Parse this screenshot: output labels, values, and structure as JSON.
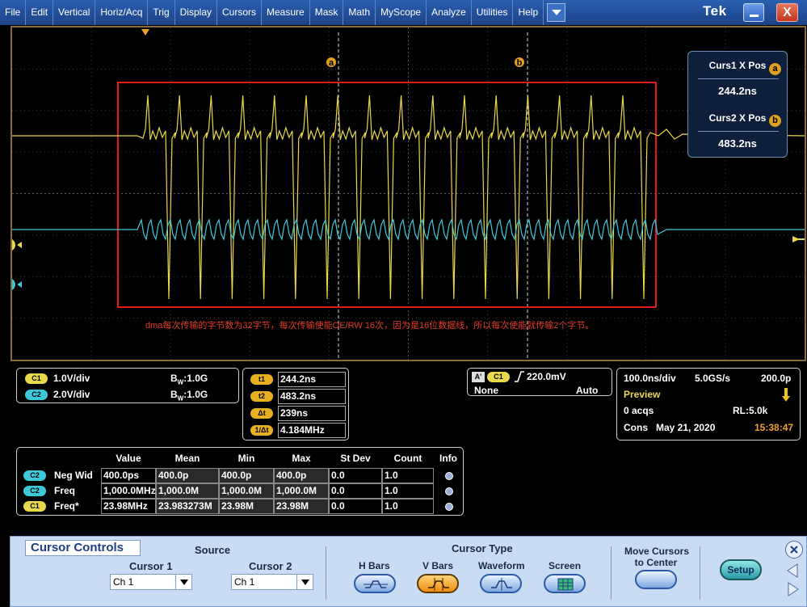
{
  "menu": [
    "File",
    "Edit",
    "Vertical",
    "Horiz/Acq",
    "Trig",
    "Display",
    "Cursors",
    "Measure",
    "Mask",
    "Math",
    "MyScope",
    "Analyze",
    "Utilities",
    "Help"
  ],
  "brand": "Tek",
  "window": {
    "close": "X"
  },
  "markers": {
    "cursor_a": "a",
    "cursor_b": "b",
    "ch1": "1",
    "ch2": "2"
  },
  "annotation": "dma每次传输的字节数为32字节，每次传输使能OE/RW 16次，因为是16位数据线，所以每次使能就传输2个字节。",
  "cursor_readout": {
    "curs1_label": "Curs1 X Pos",
    "curs1_value": "244.2ns",
    "curs2_label": "Curs2 X Pos",
    "curs2_value": "483.2ns"
  },
  "channels": [
    {
      "tag": "C1",
      "scale": "1.0V/div",
      "bw_label": "B",
      "bw_sub": "W",
      "bw": ":1.0G"
    },
    {
      "tag": "C2",
      "scale": "2.0V/div",
      "bw_label": "B",
      "bw_sub": "W",
      "bw": ":1.0G"
    }
  ],
  "cursor_times": [
    {
      "tag": "t1",
      "value": "244.2ns"
    },
    {
      "tag": "t2",
      "value": "483.2ns"
    },
    {
      "tag": "Δt",
      "value": "239ns"
    },
    {
      "tag": "1/Δt",
      "value": "4.184MHz"
    }
  ],
  "trigger": {
    "mode_tag": "A'",
    "source": "C1",
    "level": "220.0mV",
    "coupling": "None",
    "mode": "Auto"
  },
  "acquisition": {
    "timebase": "100.0ns/div",
    "sample_rate": "5.0GS/s",
    "resolution": "200.0p",
    "state": "Preview",
    "acqs": "0 acqs",
    "record_length": "RL:5.0k",
    "cons": "Cons",
    "date": "May 21, 2020",
    "time": "15:38:47"
  },
  "measurements": {
    "headers": [
      "Value",
      "Mean",
      "Min",
      "Max",
      "St Dev",
      "Count",
      "Info"
    ],
    "rows": [
      {
        "ch": "C2",
        "name": "Neg Wid",
        "value": "400.0ps",
        "mean": "400.0p",
        "min": "400.0p",
        "max": "400.0p",
        "stdev": "0.0",
        "count": "1.0"
      },
      {
        "ch": "C2",
        "name": "Freq",
        "value": "1,000.0MHz",
        "mean": "1,000.0M",
        "min": "1,000.0M",
        "max": "1,000.0M",
        "stdev": "0.0",
        "count": "1.0"
      },
      {
        "ch": "C1",
        "name": "Freq*",
        "value": "23.98MHz",
        "mean": "23.983273M",
        "min": "23.98M",
        "max": "23.98M",
        "stdev": "0.0",
        "count": "1.0"
      }
    ]
  },
  "cursor_controls": {
    "title": "Cursor Controls",
    "source_label": "Source",
    "cursor1_label": "Cursor 1",
    "cursor1_value": "Ch 1",
    "cursor2_label": "Cursor 2",
    "cursor2_value": "Ch 1",
    "type_label": "Cursor Type",
    "types": [
      "H Bars",
      "V Bars",
      "Waveform",
      "Screen"
    ],
    "selected_type": "V Bars",
    "move_line1": "Move Cursors",
    "move_line2": "to Center",
    "setup": "Setup"
  },
  "colors": {
    "ch1": "#e8d84a",
    "ch2": "#3cc8d8",
    "cursor": "#f0a030",
    "box": "#e01818"
  }
}
